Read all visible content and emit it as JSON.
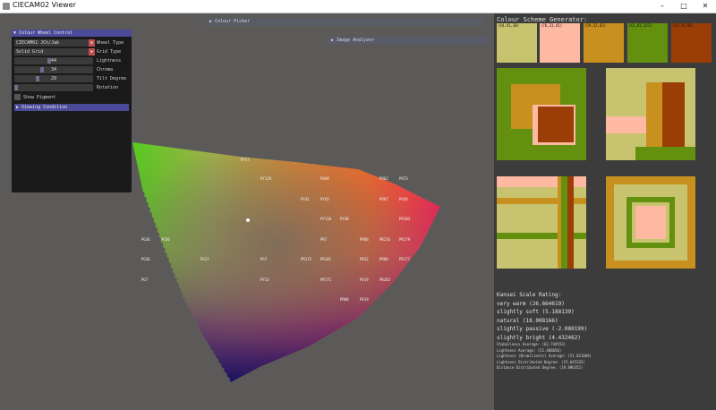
{
  "window": {
    "title": "CIECAM02 Viewer",
    "minimize_icon": "minimize-icon",
    "maximize_icon": "maximize-icon",
    "close_icon": "close-icon"
  },
  "collapsed_windows": {
    "colour_picker": "▶ Colour Picker",
    "image_analyzer": "▶ Image Analyzer"
  },
  "wheel_control": {
    "header": "▼ Colour Wheel Control",
    "wheel_type": {
      "value": "CIECAM02 JCh/Jab",
      "label": "Wheel Type"
    },
    "grid_type": {
      "value": "Solid Grid",
      "label": "Grid Type"
    },
    "lightness": {
      "value": "44",
      "label": "Lightness",
      "level": 0.44
    },
    "chroma": {
      "value": "34",
      "label": "Chroma",
      "level": 0.34
    },
    "tilt_degree": {
      "value": "29",
      "label": "Tilt Degree",
      "level": 0.29
    },
    "rotation": {
      "value": "",
      "label": "Rotation",
      "level": 0.0
    },
    "show_pigment": {
      "label": "Show Pigment",
      "checked": false
    },
    "viewing_condition": "▶ Viewing Condition"
  },
  "pigments": [
    "PY37",
    "PY129",
    "PO49",
    "PO62",
    "PO73",
    "PY42",
    "PY42",
    "PO67",
    "PO36",
    "PY110",
    "PY40",
    "PO104",
    "PG36",
    "PG50",
    "PR7",
    "PR88",
    "PR216",
    "PR179",
    "PG36",
    "PG17",
    "PG7",
    "PR175",
    "PR101",
    "PR32",
    "PR80",
    "PR177",
    "PG7",
    "PY33",
    "PR171",
    "PV19",
    "PR202",
    "PR88",
    "PV19"
  ],
  "generator": {
    "title": "Colour Scheme Generator:",
    "swatches": [
      {
        "label": "(44,41,38)",
        "color": "#c8c36e"
      },
      {
        "label": "(76,31,41)",
        "color": "#fdb9a1"
      },
      {
        "label": "(59,52,82)",
        "color": "#c8901f"
      },
      {
        "label": "(42,81,123)",
        "color": "#64900f"
      },
      {
        "label": "(31,73,81)",
        "color": "#9b3d07"
      }
    ]
  },
  "kansei": {
    "title": "Kansei Scale Rating:",
    "ratings": [
      "very warm (26.664619)",
      "slightly soft (5.188139)",
      "natural (18.008166)",
      "slightly passive (-2.080199)",
      "slightly bright (4.432462)"
    ],
    "stats": [
      "Chubaliness Average: (62.744553)",
      "Lightness Average: (51.408650)",
      "Lightness (Brumilients) Average: (51.821669)",
      "Lightness Distributed Degree: (15.645335)",
      "Distance Distributed Degree: (19.896352)"
    ]
  },
  "colors": {
    "yellow": "#c8c36e",
    "peach": "#fdb9a1",
    "ochre": "#c8901f",
    "green": "#64900f",
    "rust": "#9b3d07",
    "title_accent": "#4b4b9a"
  }
}
